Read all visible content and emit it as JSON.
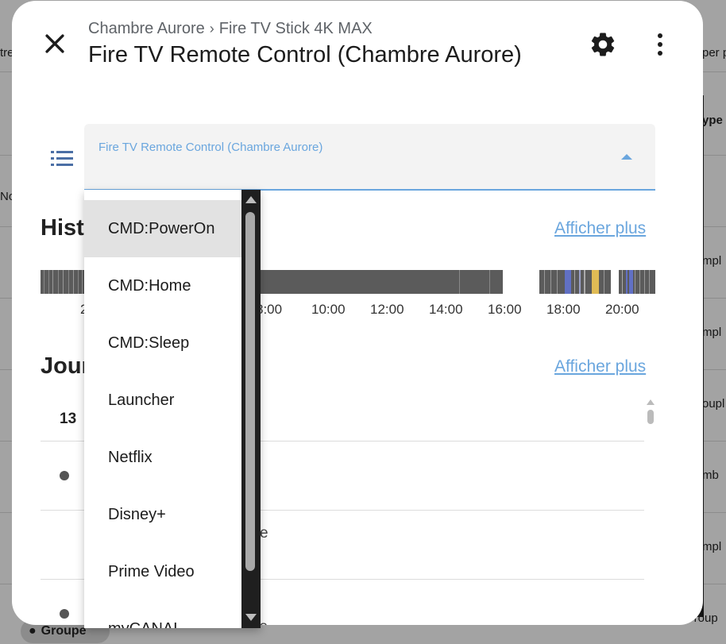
{
  "background": {
    "right_fragments": [
      "ype",
      "mpl",
      "mpl",
      "oupl",
      "mb",
      "mpl",
      "Group"
    ],
    "left_fragments": [
      "tre",
      "No"
    ],
    "right_header": "per p",
    "chip_label": "Groupe"
  },
  "dialog": {
    "breadcrumb": [
      "Chambre Aurore",
      "Fire TV Stick 4K MAX"
    ],
    "title": "Fire TV Remote Control (Chambre Aurore)",
    "select": {
      "label": "Fire TV Remote Control (Chambre Aurore)"
    },
    "history": {
      "heading": "Hist",
      "more_link": "Afficher plus",
      "ticks": [
        "2",
        "8:00",
        "10:00",
        "12:00",
        "14:00",
        "16:00",
        "18:00",
        "20:00"
      ]
    },
    "logbook": {
      "heading": "Jour",
      "more_link": "Afficher plus",
      "date": "13",
      "fragments": [
        "e",
        "s"
      ]
    }
  },
  "dropdown": {
    "items": [
      "CMD:PowerOn",
      "CMD:Home",
      "CMD:Sleep",
      "Launcher",
      "Netflix",
      "Disney+",
      "Prime Video",
      "myCANAL"
    ],
    "selected_index": 0
  },
  "colors": {
    "accent": "#6aa6de",
    "history_bar": "#5b5b5b",
    "history_blue": "#6170c4",
    "history_yellow": "#e0bb55"
  }
}
